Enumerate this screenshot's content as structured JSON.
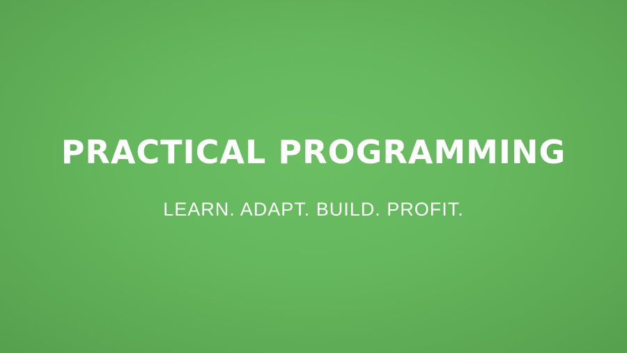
{
  "slide": {
    "title": "PRACTICAL PROGRAMMING",
    "tagline": "LEARN. ADAPT. BUILD. PROFIT.",
    "background_color": "#66b85e",
    "text_color": "#ffffff"
  }
}
